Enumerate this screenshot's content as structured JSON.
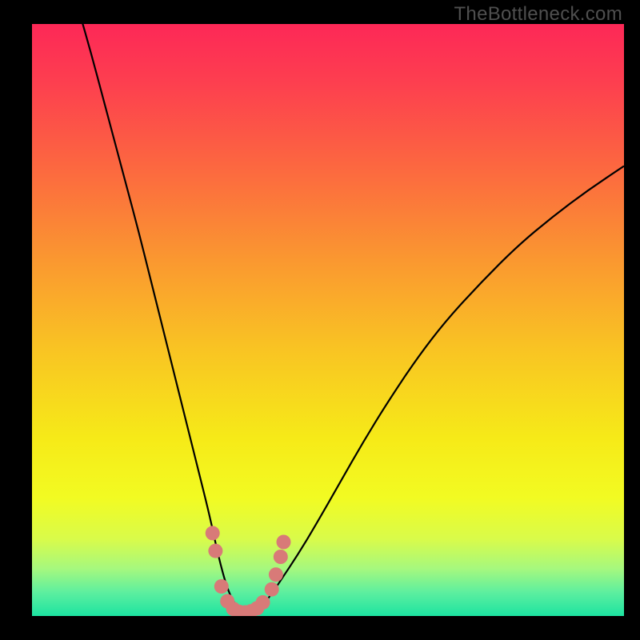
{
  "watermark": "TheBottleneck.com",
  "colors": {
    "frame": "#000000",
    "curve": "#000000",
    "dots": "#d87a78",
    "gradient_stops": [
      {
        "offset": 0.0,
        "color": "#fd2857"
      },
      {
        "offset": 0.1,
        "color": "#fd3f4f"
      },
      {
        "offset": 0.25,
        "color": "#fc6a3f"
      },
      {
        "offset": 0.4,
        "color": "#fa9830"
      },
      {
        "offset": 0.55,
        "color": "#f9c423"
      },
      {
        "offset": 0.7,
        "color": "#f6ea18"
      },
      {
        "offset": 0.8,
        "color": "#f2fb22"
      },
      {
        "offset": 0.87,
        "color": "#d9fb4a"
      },
      {
        "offset": 0.92,
        "color": "#a6f87e"
      },
      {
        "offset": 0.96,
        "color": "#5def9f"
      },
      {
        "offset": 1.0,
        "color": "#1de3a1"
      }
    ]
  },
  "chart_data": {
    "type": "line",
    "title": "",
    "xlabel": "",
    "ylabel": "",
    "xlim": [
      0,
      100
    ],
    "ylim": [
      0,
      100
    ],
    "series": [
      {
        "name": "bottleneck-curve",
        "x": [
          8,
          10,
          12,
          14,
          16,
          18,
          20,
          22,
          24,
          26,
          28,
          30,
          31.5,
          33,
          34.5,
          36,
          38,
          40,
          42,
          45,
          48,
          52,
          56,
          60,
          65,
          70,
          76,
          82,
          88,
          94,
          100
        ],
        "values": [
          102,
          95,
          87.5,
          80,
          72.5,
          65,
          57,
          49,
          41,
          33,
          25,
          17,
          10,
          4.5,
          1.5,
          0.5,
          1,
          3,
          6,
          10.5,
          15.5,
          22.5,
          29.5,
          36,
          43.5,
          50,
          56.5,
          62.5,
          67.5,
          72,
          76
        ]
      }
    ],
    "annotations": {
      "dots": [
        {
          "x": 30.5,
          "y": 14
        },
        {
          "x": 31.0,
          "y": 11
        },
        {
          "x": 32.0,
          "y": 5
        },
        {
          "x": 33.0,
          "y": 2.5
        },
        {
          "x": 34.0,
          "y": 1.2
        },
        {
          "x": 35.0,
          "y": 0.7
        },
        {
          "x": 36.0,
          "y": 0.6
        },
        {
          "x": 37.0,
          "y": 0.8
        },
        {
          "x": 38.0,
          "y": 1.3
        },
        {
          "x": 39.0,
          "y": 2.3
        },
        {
          "x": 40.5,
          "y": 4.5
        },
        {
          "x": 41.2,
          "y": 7
        },
        {
          "x": 42.0,
          "y": 10
        },
        {
          "x": 42.5,
          "y": 12.5
        }
      ]
    }
  }
}
